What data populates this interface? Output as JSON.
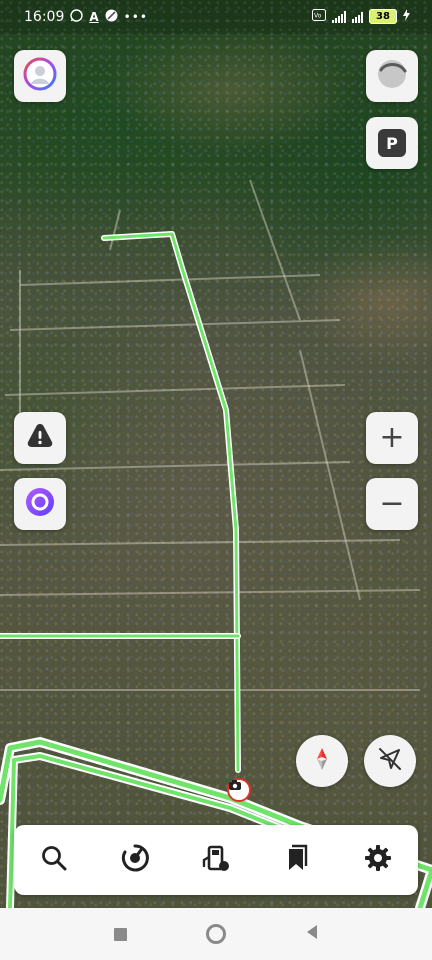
{
  "status_bar": {
    "time": "16:09",
    "left_icons": [
      "whatsapp-icon",
      "a-icon",
      "app-icon",
      "more-dots-icon"
    ],
    "right_icons": [
      "vowifi-icon",
      "signal-icon",
      "wifi-icon"
    ],
    "battery": "38"
  },
  "map": {
    "route_color": "#6fe36a",
    "camera_marker": "speed-camera-icon",
    "parking_label": "P"
  },
  "left_controls": [
    "alert-icon",
    "alice-icon"
  ],
  "right_controls": [
    "zoom-in-icon",
    "zoom-out-icon"
  ],
  "zoom": {
    "in_label": "+",
    "out_label": "−"
  },
  "toolbar": {
    "items": [
      "search-icon",
      "routes-icon",
      "fuel-icon",
      "bookmarks-icon",
      "settings-icon"
    ]
  },
  "nav_bar": [
    "recent-apps-icon",
    "home-icon",
    "back-icon"
  ]
}
